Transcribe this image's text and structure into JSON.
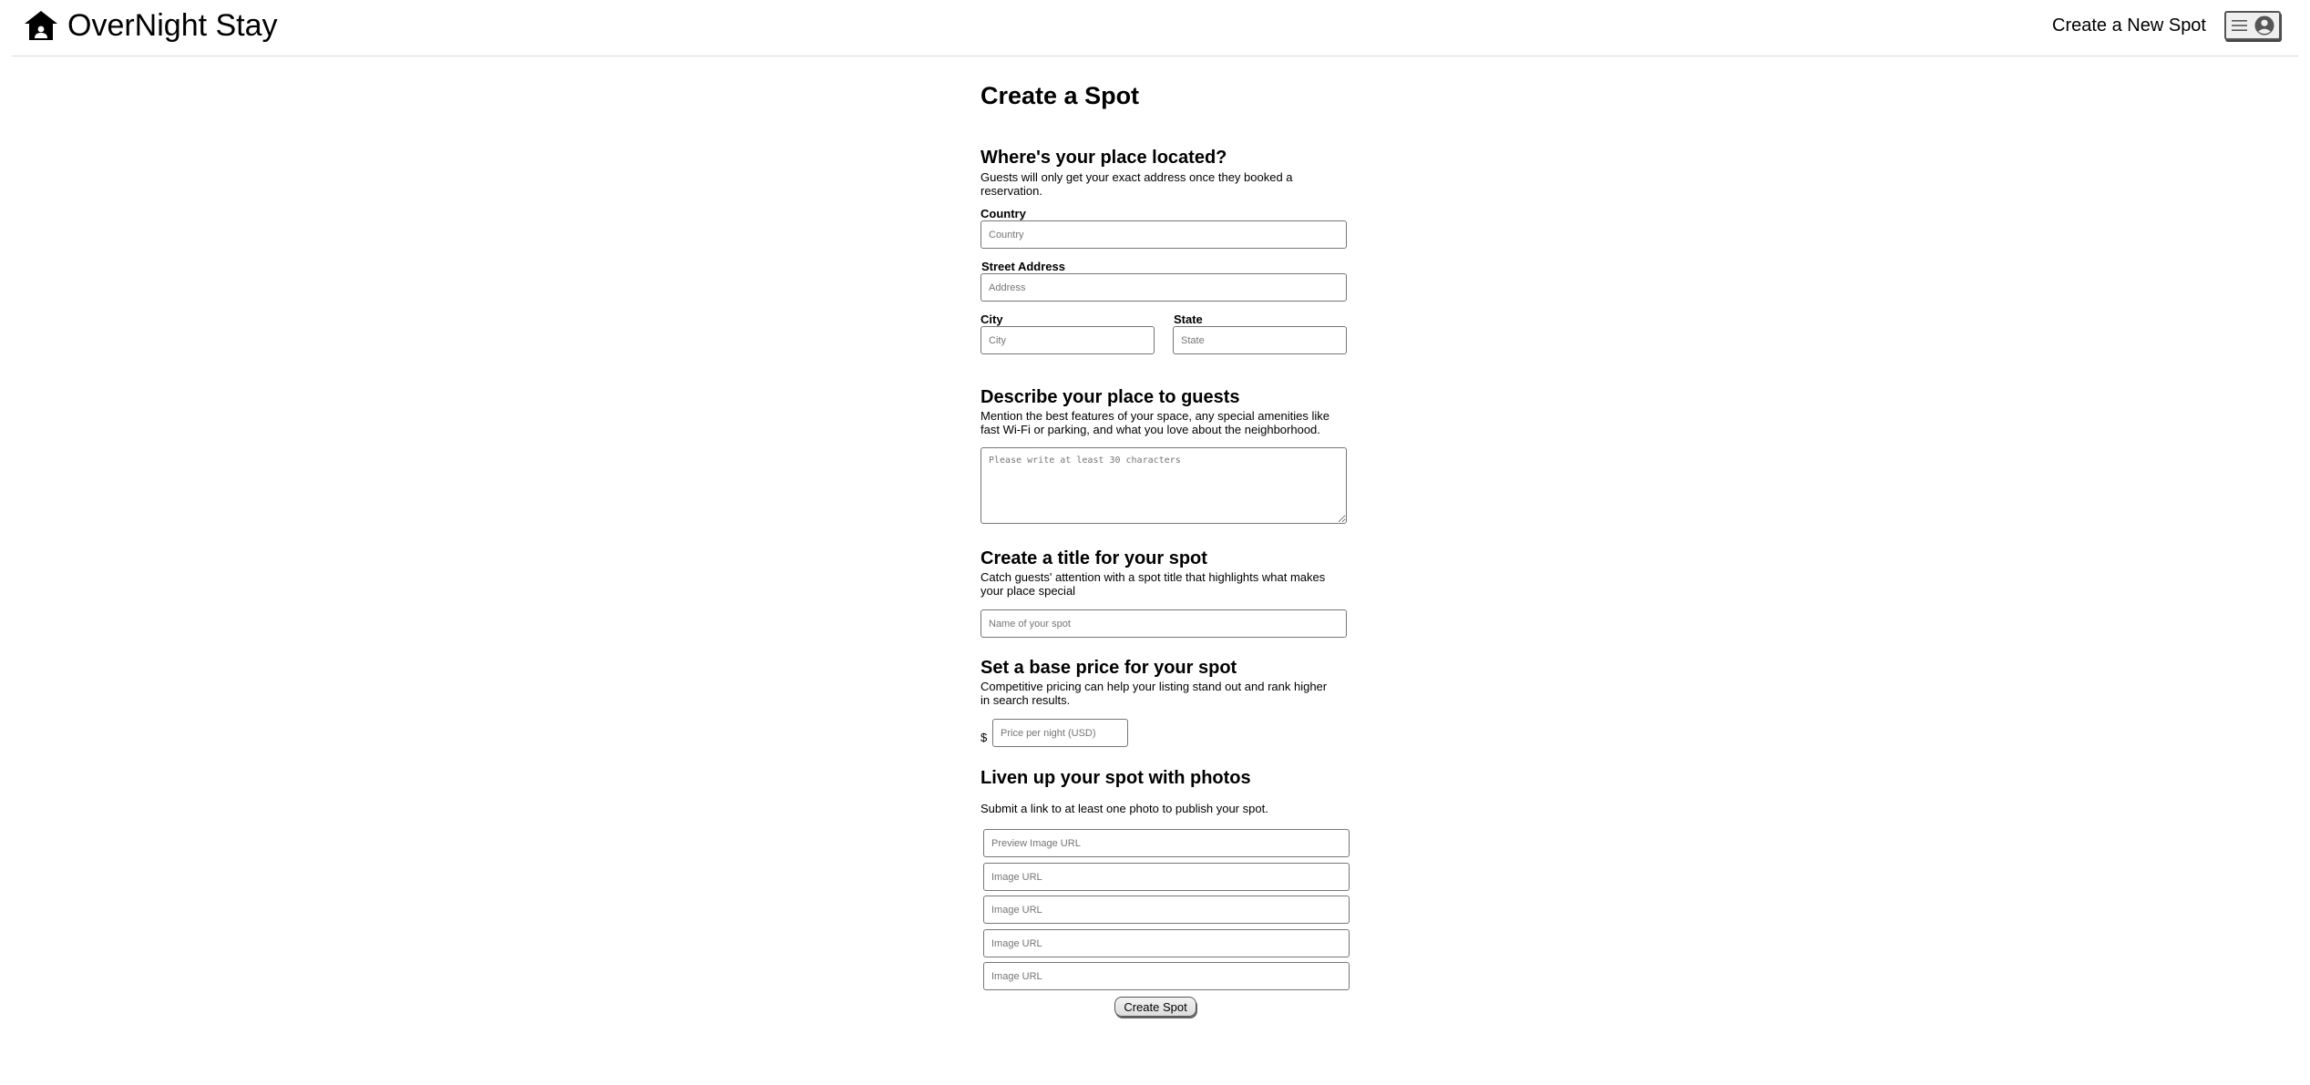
{
  "header": {
    "app_name": "OverNight Stay",
    "logo_icon": "house-icon",
    "create_link": "Create a New Spot",
    "menu_icons": [
      "hamburger-icon",
      "user-circle-icon"
    ]
  },
  "form": {
    "title": "Create a Spot",
    "location": {
      "heading": "Where's your place located?",
      "description": "Guests will only get your exact address once they booked a reservation.",
      "country_label": "Country",
      "country_placeholder": "Country",
      "address_label": "Street Address",
      "address_placeholder": "Address",
      "city_label": "City",
      "city_placeholder": "City",
      "state_label": "State",
      "state_placeholder": "State"
    },
    "describe": {
      "heading": "Describe your place to guests",
      "description": "Mention the best features of your space, any special amenities like fast Wi-Fi or parking, and what you love about the neighborhood.",
      "placeholder": "Please write at least 30 characters"
    },
    "title_section": {
      "heading": "Create a title for your spot",
      "description": "Catch guests' attention with a spot title that highlights what makes your place special",
      "placeholder": "Name of your spot"
    },
    "price": {
      "heading": "Set a base price for your spot",
      "description": "Competitive pricing can help your listing stand out and rank higher in search results.",
      "currency": "$",
      "placeholder": "Price per night (USD)"
    },
    "photos": {
      "heading": "Liven up your spot with photos",
      "description": "Submit a link to at least one photo to publish your spot.",
      "preview_placeholder": "Preview Image URL",
      "image_placeholders": [
        "Image URL",
        "Image URL",
        "Image URL",
        "Image URL"
      ]
    },
    "submit_label": "Create Spot"
  }
}
